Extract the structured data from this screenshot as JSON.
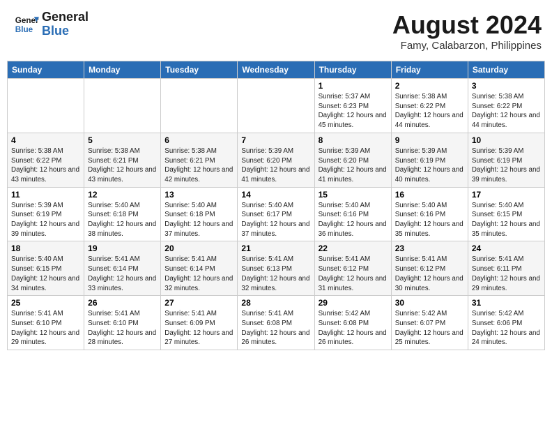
{
  "header": {
    "logo_line1": "General",
    "logo_line2": "Blue",
    "month": "August 2024",
    "location": "Famy, Calabarzon, Philippines"
  },
  "days_of_week": [
    "Sunday",
    "Monday",
    "Tuesday",
    "Wednesday",
    "Thursday",
    "Friday",
    "Saturday"
  ],
  "weeks": [
    [
      {
        "day": "",
        "info": ""
      },
      {
        "day": "",
        "info": ""
      },
      {
        "day": "",
        "info": ""
      },
      {
        "day": "",
        "info": ""
      },
      {
        "day": "1",
        "info": "Sunrise: 5:37 AM\nSunset: 6:23 PM\nDaylight: 12 hours\nand 45 minutes."
      },
      {
        "day": "2",
        "info": "Sunrise: 5:38 AM\nSunset: 6:22 PM\nDaylight: 12 hours\nand 44 minutes."
      },
      {
        "day": "3",
        "info": "Sunrise: 5:38 AM\nSunset: 6:22 PM\nDaylight: 12 hours\nand 44 minutes."
      }
    ],
    [
      {
        "day": "4",
        "info": "Sunrise: 5:38 AM\nSunset: 6:22 PM\nDaylight: 12 hours\nand 43 minutes."
      },
      {
        "day": "5",
        "info": "Sunrise: 5:38 AM\nSunset: 6:21 PM\nDaylight: 12 hours\nand 43 minutes."
      },
      {
        "day": "6",
        "info": "Sunrise: 5:38 AM\nSunset: 6:21 PM\nDaylight: 12 hours\nand 42 minutes."
      },
      {
        "day": "7",
        "info": "Sunrise: 5:39 AM\nSunset: 6:20 PM\nDaylight: 12 hours\nand 41 minutes."
      },
      {
        "day": "8",
        "info": "Sunrise: 5:39 AM\nSunset: 6:20 PM\nDaylight: 12 hours\nand 41 minutes."
      },
      {
        "day": "9",
        "info": "Sunrise: 5:39 AM\nSunset: 6:19 PM\nDaylight: 12 hours\nand 40 minutes."
      },
      {
        "day": "10",
        "info": "Sunrise: 5:39 AM\nSunset: 6:19 PM\nDaylight: 12 hours\nand 39 minutes."
      }
    ],
    [
      {
        "day": "11",
        "info": "Sunrise: 5:39 AM\nSunset: 6:19 PM\nDaylight: 12 hours\nand 39 minutes."
      },
      {
        "day": "12",
        "info": "Sunrise: 5:40 AM\nSunset: 6:18 PM\nDaylight: 12 hours\nand 38 minutes."
      },
      {
        "day": "13",
        "info": "Sunrise: 5:40 AM\nSunset: 6:18 PM\nDaylight: 12 hours\nand 37 minutes."
      },
      {
        "day": "14",
        "info": "Sunrise: 5:40 AM\nSunset: 6:17 PM\nDaylight: 12 hours\nand 37 minutes."
      },
      {
        "day": "15",
        "info": "Sunrise: 5:40 AM\nSunset: 6:16 PM\nDaylight: 12 hours\nand 36 minutes."
      },
      {
        "day": "16",
        "info": "Sunrise: 5:40 AM\nSunset: 6:16 PM\nDaylight: 12 hours\nand 35 minutes."
      },
      {
        "day": "17",
        "info": "Sunrise: 5:40 AM\nSunset: 6:15 PM\nDaylight: 12 hours\nand 35 minutes."
      }
    ],
    [
      {
        "day": "18",
        "info": "Sunrise: 5:40 AM\nSunset: 6:15 PM\nDaylight: 12 hours\nand 34 minutes."
      },
      {
        "day": "19",
        "info": "Sunrise: 5:41 AM\nSunset: 6:14 PM\nDaylight: 12 hours\nand 33 minutes."
      },
      {
        "day": "20",
        "info": "Sunrise: 5:41 AM\nSunset: 6:14 PM\nDaylight: 12 hours\nand 32 minutes."
      },
      {
        "day": "21",
        "info": "Sunrise: 5:41 AM\nSunset: 6:13 PM\nDaylight: 12 hours\nand 32 minutes."
      },
      {
        "day": "22",
        "info": "Sunrise: 5:41 AM\nSunset: 6:12 PM\nDaylight: 12 hours\nand 31 minutes."
      },
      {
        "day": "23",
        "info": "Sunrise: 5:41 AM\nSunset: 6:12 PM\nDaylight: 12 hours\nand 30 minutes."
      },
      {
        "day": "24",
        "info": "Sunrise: 5:41 AM\nSunset: 6:11 PM\nDaylight: 12 hours\nand 29 minutes."
      }
    ],
    [
      {
        "day": "25",
        "info": "Sunrise: 5:41 AM\nSunset: 6:10 PM\nDaylight: 12 hours\nand 29 minutes."
      },
      {
        "day": "26",
        "info": "Sunrise: 5:41 AM\nSunset: 6:10 PM\nDaylight: 12 hours\nand 28 minutes."
      },
      {
        "day": "27",
        "info": "Sunrise: 5:41 AM\nSunset: 6:09 PM\nDaylight: 12 hours\nand 27 minutes."
      },
      {
        "day": "28",
        "info": "Sunrise: 5:41 AM\nSunset: 6:08 PM\nDaylight: 12 hours\nand 26 minutes."
      },
      {
        "day": "29",
        "info": "Sunrise: 5:42 AM\nSunset: 6:08 PM\nDaylight: 12 hours\nand 26 minutes."
      },
      {
        "day": "30",
        "info": "Sunrise: 5:42 AM\nSunset: 6:07 PM\nDaylight: 12 hours\nand 25 minutes."
      },
      {
        "day": "31",
        "info": "Sunrise: 5:42 AM\nSunset: 6:06 PM\nDaylight: 12 hours\nand 24 minutes."
      }
    ]
  ]
}
